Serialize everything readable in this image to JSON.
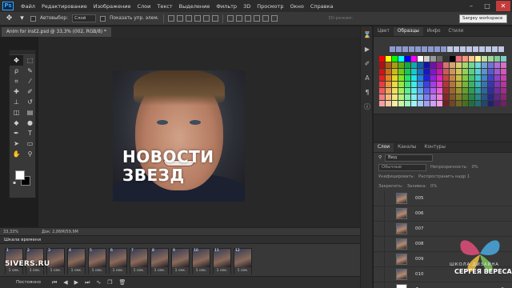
{
  "app": {
    "logo": "Ps"
  },
  "menu": [
    "Файл",
    "Редактирование",
    "Изображение",
    "Слои",
    "Текст",
    "Выделение",
    "Фильтр",
    "3D",
    "Просмотр",
    "Окно",
    "Справка"
  ],
  "window_controls": {
    "minimize": "–",
    "maximize": "□",
    "close": "✕"
  },
  "options_bar": {
    "auto_select_label": "Автовыбор:",
    "auto_select_value": "Слой",
    "show_controls_label": "Показать упр. элем.",
    "mode_3d_label": "3D-режим:",
    "workspace": "Sargey workspace"
  },
  "document": {
    "tab_title": "Anim for inst2.psd @ 33,3% (002, RGB/8) *",
    "headline_line1": "НОВОСТИ",
    "headline_line2": "ЗВЕЗД"
  },
  "status": {
    "zoom": "33,33%",
    "doc_size": "Док: 2,86M/59,9M"
  },
  "timeline": {
    "title": "Шкала времени",
    "frames": [
      {
        "num": "1",
        "label": "1 сек."
      },
      {
        "num": "2",
        "label": "1 сек."
      },
      {
        "num": "3",
        "label": "1 сек."
      },
      {
        "num": "4",
        "label": "1 сек."
      },
      {
        "num": "5",
        "label": "1 сек."
      },
      {
        "num": "6",
        "label": "1 сек."
      },
      {
        "num": "7",
        "label": "1 сек."
      },
      {
        "num": "8",
        "label": "1 сек."
      },
      {
        "num": "9",
        "label": "1 сек."
      },
      {
        "num": "10",
        "label": "1 сек."
      },
      {
        "num": "11",
        "label": "1 сек."
      },
      {
        "num": "12",
        "label": "1 сек."
      }
    ],
    "loop": "Постоянно",
    "site_watermark": "5IVERS.RU"
  },
  "swatches_panel": {
    "tabs": [
      "Цвет",
      "Образцы",
      "Инфо",
      "Стили"
    ],
    "active_tab": "Образцы"
  },
  "layers_panel": {
    "tabs": [
      "Слои",
      "Каналы",
      "Контуры"
    ],
    "active_tab": "Слои",
    "kind_filter": "Вид",
    "blend_mode": "Обычные",
    "opacity_label": "Непрозрачность:",
    "opacity_value": "0%",
    "unify_label": "Унифицировать:",
    "propagate_label": "Распространить кадр 1",
    "lock_label": "Закрепить:",
    "fill_label": "Заливка:",
    "fill_value": "0%",
    "layers": [
      {
        "name": "005",
        "thumb": "photo"
      },
      {
        "name": "006",
        "thumb": "photo"
      },
      {
        "name": "007",
        "thumb": "photo"
      },
      {
        "name": "008",
        "thumb": "photo"
      },
      {
        "name": "009",
        "thumb": "photo"
      },
      {
        "name": "010",
        "thumb": "photo"
      },
      {
        "name": "Фон",
        "thumb": "white"
      }
    ]
  },
  "brand": {
    "line1": "ШКОЛА ДИЗАЙНА",
    "line2": "СЕРГЕЯ ВЕРЕСА"
  }
}
